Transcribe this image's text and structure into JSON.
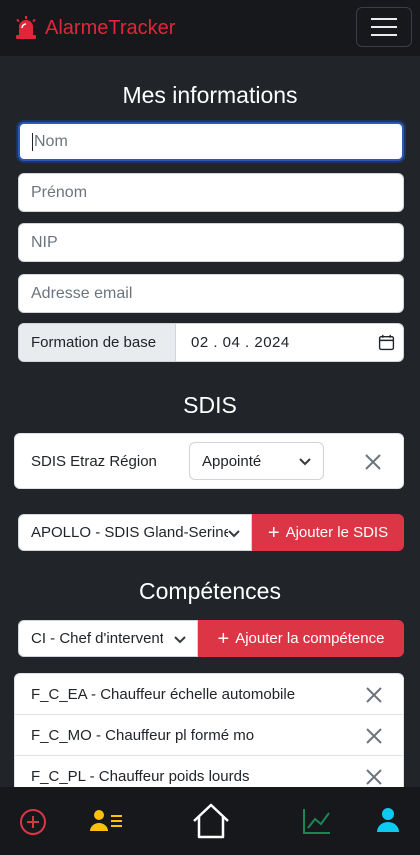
{
  "app": {
    "title": "AlarmeTracker"
  },
  "sections": {
    "info_title": "Mes informations",
    "sdis_title": "SDIS",
    "comp_title": "Compétences"
  },
  "form": {
    "nom_placeholder": "Nom",
    "prenom_placeholder": "Prénom",
    "nip_placeholder": "NIP",
    "email_placeholder": "Adresse email",
    "formation_label": "Formation de base",
    "formation_date": "02 . 04 . 2024"
  },
  "sdis_card": {
    "name": "SDIS Etraz Région",
    "rank": "Appointé"
  },
  "sdis_add": {
    "selected": "APOLLO - SDIS Gland-Serine",
    "button": "Ajouter le SDIS"
  },
  "comp_add": {
    "selected": "CI - Chef d'intervention",
    "button": "Ajouter la compétence"
  },
  "competences": [
    {
      "label": "F_C_EA - Chauffeur échelle automobile"
    },
    {
      "label": "F_C_MO - Chauffeur pl formé mo"
    },
    {
      "label": "F_C_PL - Chauffeur poids lourds"
    }
  ],
  "colors": {
    "brand_red": "#e0273a",
    "button_red": "#dc3545",
    "background": "#212529",
    "nav_bg": "#16181b",
    "nav_add_red": "#dc3545",
    "nav_team_yellow": "#ffc107",
    "nav_stats_green": "#198754",
    "nav_profile_cyan": "#0dcaf0"
  },
  "bottom_nav": [
    "plus-circle-icon",
    "team-list-icon",
    "home-icon",
    "stats-icon",
    "profile-icon"
  ]
}
